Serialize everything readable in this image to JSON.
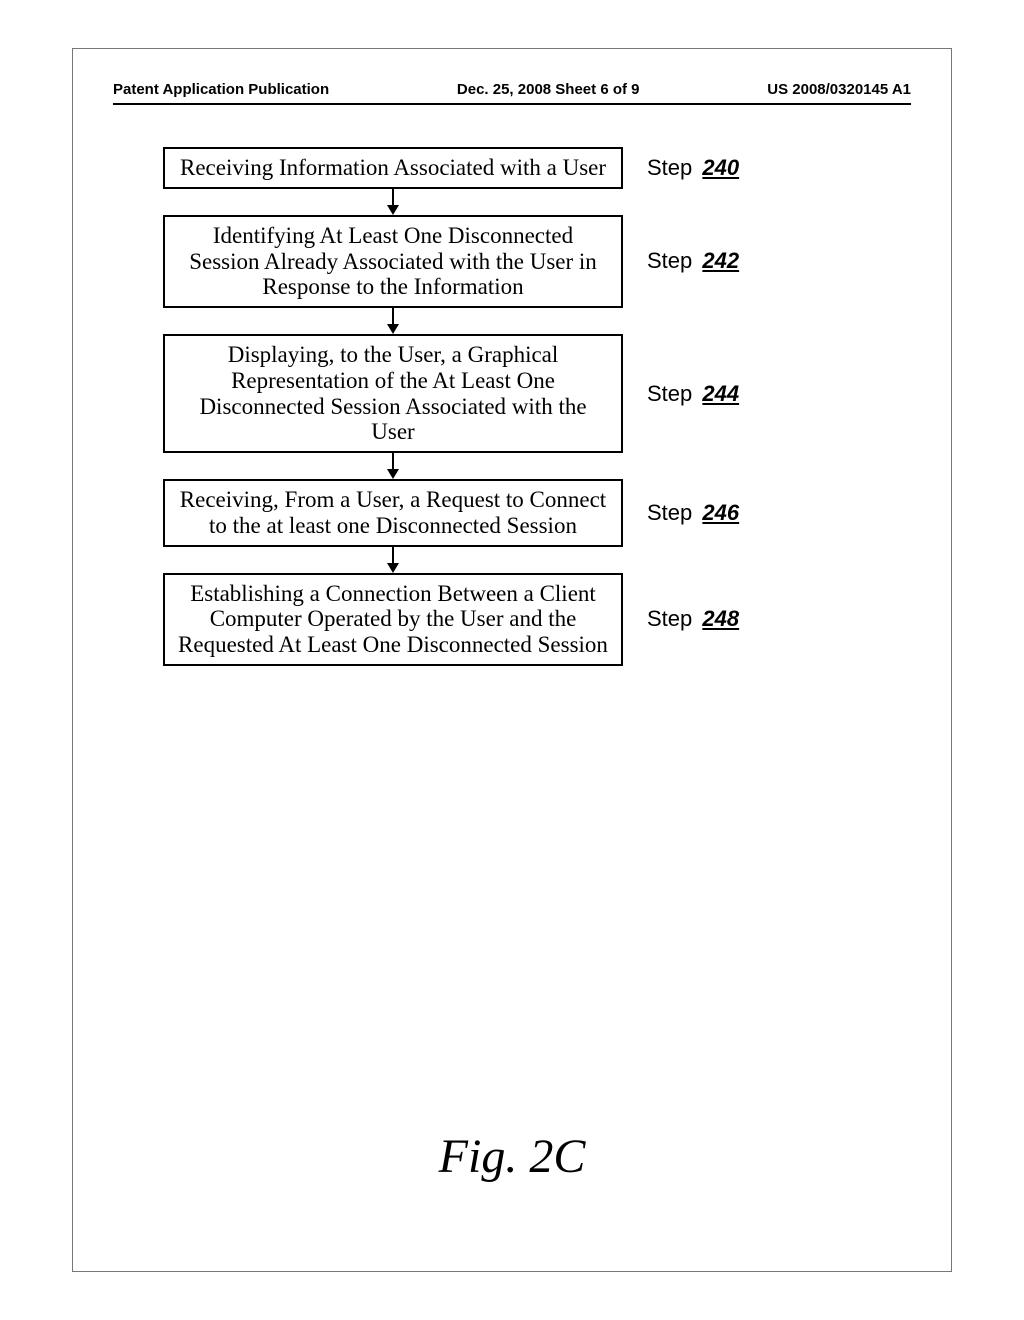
{
  "header": {
    "left": "Patent Application Publication",
    "mid": "Dec. 25, 2008  Sheet 6 of 9",
    "right": "US 2008/0320145 A1"
  },
  "steps": [
    {
      "text": "Receiving Information Associated with a User",
      "label": "Step",
      "num": "240"
    },
    {
      "text": "Identifying At Least One Disconnected Session Already Associated with the User in Response to the Information",
      "label": "Step",
      "num": "242"
    },
    {
      "text": "Displaying, to the User, a Graphical Representation of the At Least One Disconnected Session Associated with the User",
      "label": "Step",
      "num": "244"
    },
    {
      "text": "Receiving, From a User, a Request to Connect to the at least one Disconnected Session",
      "label": "Step",
      "num": "246"
    },
    {
      "text": "Establishing a Connection Between a Client Computer Operated by the User and the Requested At Least One Disconnected Session",
      "label": "Step",
      "num": "248"
    }
  ],
  "figure_label": "Fig. 2C"
}
